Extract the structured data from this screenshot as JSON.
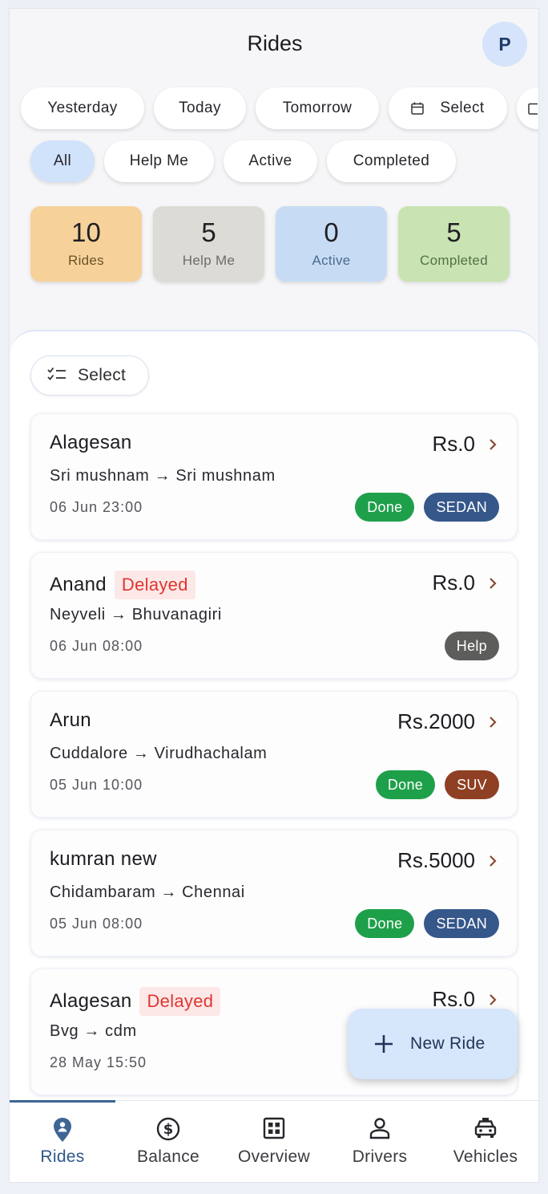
{
  "header": {
    "title": "Rides",
    "avatar_letter": "P"
  },
  "date_filters": [
    {
      "label": "Yesterday"
    },
    {
      "label": "Today"
    },
    {
      "label": "Tomorrow"
    },
    {
      "label": "Select",
      "icon": "calendar-icon"
    }
  ],
  "status_filters": [
    {
      "label": "All",
      "selected": true
    },
    {
      "label": "Help Me"
    },
    {
      "label": "Active"
    },
    {
      "label": "Completed"
    }
  ],
  "stats": [
    {
      "value": "10",
      "label": "Rides",
      "bg": "#f6d29a",
      "fg": "#6b5428"
    },
    {
      "value": "5",
      "label": "Help Me",
      "bg": "#dcdbd6",
      "fg": "#6d6c68"
    },
    {
      "value": "0",
      "label": "Active",
      "bg": "#c7dcf4",
      "fg": "#4b6a8e"
    },
    {
      "value": "5",
      "label": "Completed",
      "bg": "#cae3b2",
      "fg": "#52704a"
    }
  ],
  "select_button": {
    "label": "Select",
    "icon": "checklist-icon"
  },
  "rides": [
    {
      "name": "Alagesan",
      "delayed": "",
      "price": "Rs.0",
      "route": "Sri mushnam → Sri mushnam",
      "time": "06 Jun  23:00",
      "badges": [
        {
          "label": "Done",
          "type": "done"
        },
        {
          "label": "SEDAN",
          "type": "sedan"
        }
      ]
    },
    {
      "name": "Anand",
      "delayed": "Delayed",
      "price": "Rs.0",
      "route": "Neyveli → Bhuvanagiri",
      "time": "06 Jun  08:00",
      "badges": [
        {
          "label": "Help",
          "type": "help"
        }
      ]
    },
    {
      "name": "Arun",
      "delayed": "",
      "price": "Rs.2000",
      "route": "Cuddalore → Virudhachalam",
      "time": "05 Jun  10:00",
      "badges": [
        {
          "label": "Done",
          "type": "done"
        },
        {
          "label": "SUV",
          "type": "suv"
        }
      ]
    },
    {
      "name": "kumran new",
      "delayed": "",
      "price": "Rs.5000",
      "route": "Chidambaram → Chennai",
      "time": "05 Jun  08:00",
      "badges": [
        {
          "label": "Done",
          "type": "done"
        },
        {
          "label": "SEDAN",
          "type": "sedan"
        }
      ]
    },
    {
      "name": "Alagesan",
      "delayed": "Delayed",
      "price": "Rs.0",
      "route": "Bvg → cdm",
      "time": "28 May  15:50",
      "badges": []
    }
  ],
  "fab": {
    "label": "New Ride",
    "icon": "plus-icon"
  },
  "bottom_nav": [
    {
      "label": "Rides",
      "icon": "location-pin-icon",
      "active": true
    },
    {
      "label": "Balance",
      "icon": "dollar-circle-icon"
    },
    {
      "label": "Overview",
      "icon": "grid-icon"
    },
    {
      "label": "Drivers",
      "icon": "person-icon"
    },
    {
      "label": "Vehicles",
      "icon": "car-icon"
    }
  ]
}
